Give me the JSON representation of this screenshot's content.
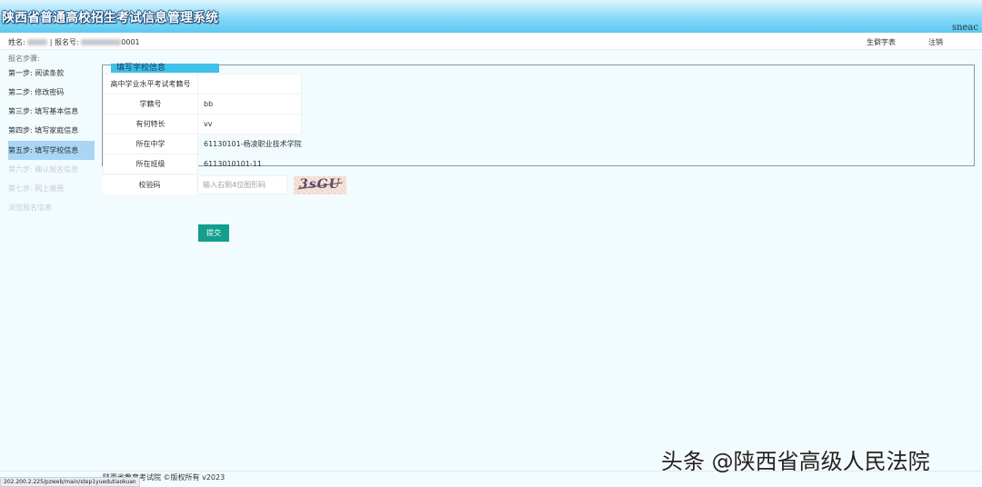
{
  "header": {
    "title": "陕西省普通高校招生考试信息管理系统",
    "brand": "sneac"
  },
  "userbar": {
    "name_label": "姓名:",
    "separator": "| 报名号:",
    "reg_suffix": "0001",
    "links": {
      "account": "生僻字表",
      "logout": "注销"
    }
  },
  "sidebar": {
    "heading": "报名步骤:",
    "steps": [
      {
        "label": "第一步: 阅读条款",
        "state": "done"
      },
      {
        "label": "第二步: 修改密码",
        "state": "done"
      },
      {
        "label": "第三步: 填写基本信息",
        "state": "done"
      },
      {
        "label": "第四步: 填写家庭信息",
        "state": "done"
      },
      {
        "label": "第五步: 填写学校信息",
        "state": "active"
      },
      {
        "label": "第六步: 确认报名信息",
        "state": "disabled"
      },
      {
        "label": "第七步: 网上缴费",
        "state": "disabled"
      },
      {
        "label": "浏览报名信息",
        "state": "disabled"
      }
    ]
  },
  "school_form": {
    "legend": "填写学校信息",
    "fields": [
      {
        "label": "高中学业水平考试考籍号",
        "value": ""
      },
      {
        "label": "学籍号",
        "value": "bb"
      },
      {
        "label": "有何特长",
        "value": "vv"
      },
      {
        "label": "所在中学",
        "value": "61130101-杨凌职业技术学院"
      },
      {
        "label": "所在班级",
        "value": "6113010101-11"
      }
    ]
  },
  "captcha": {
    "label": "校验码",
    "placeholder": "输入右侧4位图形码",
    "image_text": "3sGU"
  },
  "submit_label": "提交",
  "footer": "陕西省教育考试院 ©版权所有 v2023",
  "status_url": "202.200.2.225/pzweb/main/step1yuedutiaokuan",
  "watermark": "头条 @陕西省高级人民法院",
  "colors": {
    "accent": "#139e8d",
    "legend_bg": "#3fc0e8",
    "active_step_bg": "#a9d6f5"
  }
}
